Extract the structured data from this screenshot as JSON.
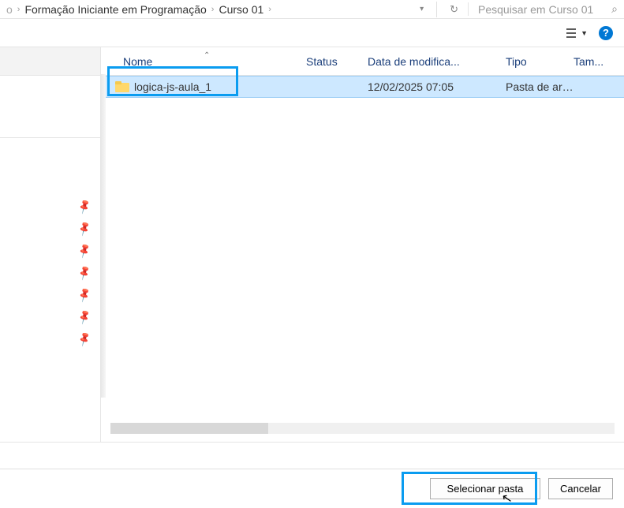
{
  "breadcrumb": {
    "partial_left": "o",
    "crumb1": "Formação Iniciante em Programação",
    "crumb2": "Curso 01"
  },
  "search": {
    "placeholder": "Pesquisar em Curso 01"
  },
  "columns": {
    "name": "Nome",
    "status": "Status",
    "date": "Data de modifica...",
    "type": "Tipo",
    "size": "Tam..."
  },
  "rows": [
    {
      "name": "logica-js-aula_1",
      "status": "",
      "date": "12/02/2025 07:05",
      "type": "Pasta de arqui...",
      "size": ""
    }
  ],
  "buttons": {
    "select": "Selecionar pasta",
    "cancel": "Cancelar"
  },
  "help_label": "?"
}
